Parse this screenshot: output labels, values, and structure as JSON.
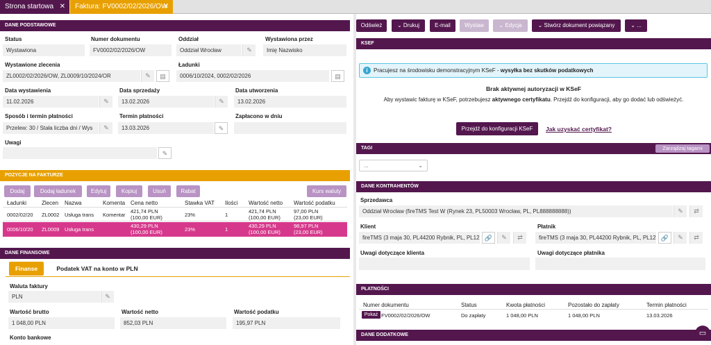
{
  "tabs": {
    "start": "Strona startowa",
    "invoice": "Faktura: FV0002/02/2026/OW",
    "close": "✕"
  },
  "basic": {
    "header": "DANE PODSTAWOWE",
    "status_label": "Status",
    "status": "Wystawiona",
    "docnum_label": "Numer dokumentu",
    "docnum": "FV0002/02/2026/OW",
    "branch_label": "Oddział",
    "branch": "Oddział Wrocław",
    "issuedby_label": "Wystawiona przez",
    "issuedby": "Imię Nazwisko",
    "order_label": "Wystawione zlecenia",
    "order": "ZL0002/02/2026/OW, ZL0009/10/2024/OR",
    "loads_label": "Ładunki",
    "loads": "0006/10/2024, 0002/02/2026",
    "issuedate_label": "Data wystawienia",
    "issuedate": "11.02.2026",
    "saledate_label": "Data sprzedaży",
    "saledate": "13.02.2026",
    "createdate_label": "Data utworzenia",
    "createdate": "13.02.2026",
    "payment_label": "Sposób i termin płatności",
    "payment": "Przelew: 30 / Stała liczba dni / Wys",
    "term_label": "Termin płatności",
    "term": "13.03.2026",
    "paid_label": "Zapłacono w dniu",
    "paid": "",
    "notes_label": "Uwagi",
    "notes": ""
  },
  "items": {
    "header": "POZYCJE NA FAKTURZE",
    "buttons": [
      "Dodaj",
      "Dodaj ładunek",
      "Edytuj",
      "Kopiuj",
      "Usuń",
      "Rabat"
    ],
    "currency_button": "Kurs waluty",
    "columns": [
      "Ładunki",
      "Zlecen",
      "Nazwa",
      "Komenta",
      "Cena netto",
      "Stawka VAT",
      "Ilości",
      "Wartość netto",
      "Wartość podatku"
    ],
    "rows": [
      [
        "0002/02/20",
        "ZL0002",
        "Usługa trans",
        "Komentar",
        "421,74 PLN",
        "(100,00 EUR)",
        "23%",
        "1",
        "421,74 PLN",
        "(100,00 EUR)",
        "97,00 PLN",
        "(23,00 EUR)"
      ],
      [
        "0006/10/20",
        "ZL0009",
        "Usługa trans",
        "",
        "430,29 PLN",
        "(100,00 EUR)",
        "23%",
        "1",
        "430,29 PLN",
        "(100,00 EUR)",
        "98,97 PLN",
        "(23,00 EUR)"
      ]
    ]
  },
  "finance": {
    "header": "DANE FINANSOWE",
    "tab1": "Finanse",
    "tab2": "Podatek VAT na konto w PLN",
    "currency_label": "Waluta faktury",
    "currency": "PLN",
    "gross_label": "Wartość brutto",
    "gross": "1 048,00 PLN",
    "net_label": "Wartość netto",
    "net": "852,03 PLN",
    "tax_label": "Wartość podatku",
    "tax": "195,97 PLN",
    "bank_label": "Konto bankowe"
  },
  "toolbar": {
    "refresh": "Odśwież",
    "print": "Drukuj",
    "email": "E-mail",
    "issue": "Wystaw",
    "edit": "Edycja",
    "create": "Stwórz dokument powiązany",
    "more": "..."
  },
  "ksef": {
    "header": "KSEF",
    "info_normal": "Pracujesz na środowisku demonstracyjnym KSeF - ",
    "info_bold": "wysyłka bez skutków podatkowych",
    "title": "Brak aktywnej autoryzacji w KSeF",
    "msg1": "Aby wystawic fakturę w KSeF, potrzebujesz ",
    "msg_bold": "aktywnego certyfikatu",
    "msg2": ". Przejdź do konfiguracji, aby go dodać lub odświeżyć.",
    "config_button": "Przejdź do konfiguracji KSeF",
    "cert_link": "Jak uzyskać certyfikat?"
  },
  "tags": {
    "header": "TAGI",
    "manage": "Zarządzaj tagami",
    "select": "..."
  },
  "parties": {
    "header": "DANE KONTRAHENTÓW",
    "seller_label": "Sprzedawca",
    "seller": "Oddział Wrocław (fireTMS Test W (Rynek 23, PL50003 Wrocław, PL, PL888888888))",
    "client_label": "Klient",
    "client": "fireTMS (3 maja 30, PL44200 Rybnik, PL, PL12",
    "payer_label": "Płatnik",
    "payer": "fireTMS (3 maja 30, PL44200 Rybnik, PL, PL12",
    "client_notes_label": "Uwagi dotyczące klienta",
    "payer_notes_label": "Uwagi dotyczące płatnika"
  },
  "payments": {
    "header": "PŁATNOŚCI",
    "columns": [
      "Numer dokumentu",
      "Status",
      "Kwota płatności",
      "Pozostało do zapłaty",
      "Termin płatności"
    ],
    "show_button": "Pokaż",
    "docnum": "FV0002/02/2026/OW",
    "status": "Do zapłaty",
    "amount": "1 048,00 PLN",
    "remaining": "1 048,00 PLN",
    "due": "13.03.2026"
  },
  "additional": {
    "header": "DANE DODATKOWE"
  },
  "colors": {
    "primary": "#53174e",
    "accent": "#e8a000",
    "selected_row": "#d6398c",
    "light_button": "#b893c4"
  }
}
